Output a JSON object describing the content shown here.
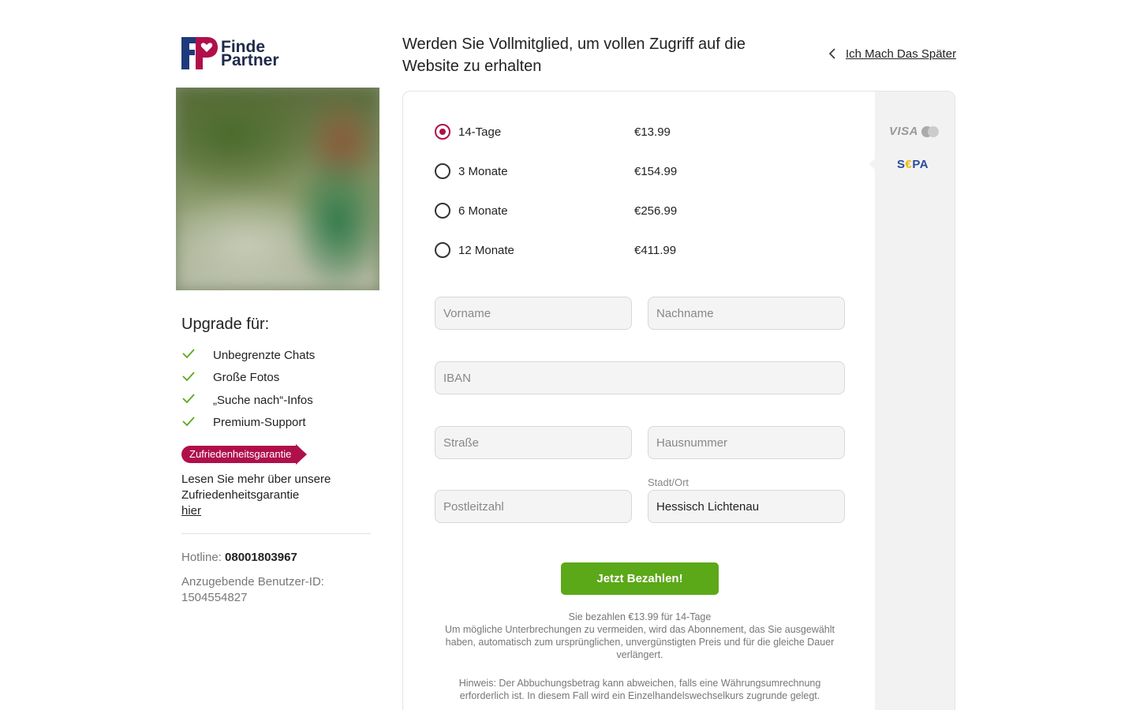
{
  "brand": {
    "name_line1": "Finde",
    "name_line2": "Partner",
    "primary_color": "#b0104a",
    "navy_color": "#1e3a7a"
  },
  "header": {
    "headline": "Werden Sie Vollmitglied, um vollen Zugriff auf die Website zu erhalten",
    "later_link": "Ich Mach Das Später"
  },
  "sidebar": {
    "upgrade_title": "Upgrade für:",
    "features": [
      "Unbegrenzte Chats",
      "Große Fotos",
      "„Suche nach“-Infos",
      "Premium-Support"
    ],
    "badge": "Zufriedenheitsgarantie",
    "guarantee_text": "Lesen Sie mehr über unsere Zufriedenheitsgarantie",
    "guarantee_link": "hier",
    "hotline_label": "Hotline:",
    "hotline_number": "08001803967",
    "user_id_label": "Anzugebende Benutzer-ID:",
    "user_id": "1504554827"
  },
  "plans": [
    {
      "label": "14-Tage",
      "price": "€13.99",
      "selected": true
    },
    {
      "label": "3 Monate",
      "price": "€154.99",
      "selected": false
    },
    {
      "label": "6 Monate",
      "price": "€256.99",
      "selected": false
    },
    {
      "label": "12 Monate",
      "price": "€411.99",
      "selected": false
    }
  ],
  "payment_methods": {
    "visa": "VISA",
    "sepa_prefix": "S",
    "sepa_euro": "€",
    "sepa_suffix": "PA"
  },
  "form": {
    "first_name_placeholder": "Vorname",
    "last_name_placeholder": "Nachname",
    "iban_placeholder": "IBAN",
    "street_placeholder": "Straße",
    "house_number_placeholder": "Hausnummer",
    "postal_code_placeholder": "Postleitzahl",
    "city_label": "Stadt/Ort",
    "city_value": "Hessisch Lichtenau"
  },
  "submit_label": "Jetzt Bezahlen!",
  "summary_line1": "Sie bezahlen €13.99 für 14-Tage",
  "summary_line2": "Um mögliche Unterbrechungen zu vermeiden, wird das Abonnement, das Sie ausgewählt haben, automatisch zum ursprünglichen, unvergünstigten Preis und für die gleiche Dauer verlängert.",
  "notice": "Hinweis: Der Abbuchungsbetrag kann abweichen, falls eine Währungsumrechnung erforderlich ist. In diesem Fall wird ein Einzelhandelswechselkurs zugrunde gelegt."
}
